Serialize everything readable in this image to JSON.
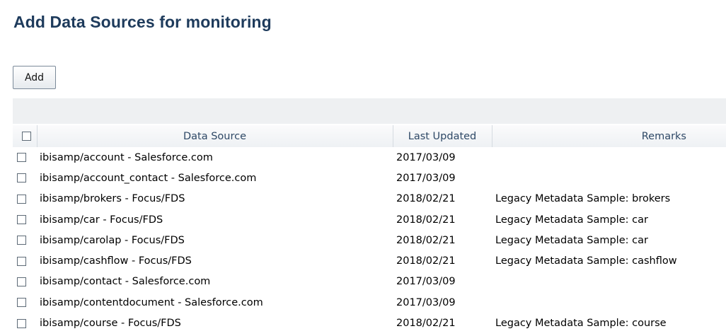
{
  "header": {
    "title": "Add Data Sources for monitoring"
  },
  "toolbar": {
    "add_label": "Add"
  },
  "table": {
    "columns": {
      "source": "Data Source",
      "updated": "Last Updated",
      "remarks": "Remarks"
    },
    "rows": [
      {
        "source": "ibisamp/account - Salesforce.com",
        "updated": "2017/03/09",
        "remarks": ""
      },
      {
        "source": "ibisamp/account_contact - Salesforce.com",
        "updated": "2017/03/09",
        "remarks": ""
      },
      {
        "source": "ibisamp/brokers - Focus/FDS",
        "updated": "2018/02/21",
        "remarks": "Legacy Metadata Sample: brokers"
      },
      {
        "source": "ibisamp/car - Focus/FDS",
        "updated": "2018/02/21",
        "remarks": "Legacy Metadata Sample: car"
      },
      {
        "source": "ibisamp/carolap - Focus/FDS",
        "updated": "2018/02/21",
        "remarks": "Legacy Metadata Sample: car"
      },
      {
        "source": "ibisamp/cashflow - Focus/FDS",
        "updated": "2018/02/21",
        "remarks": "Legacy Metadata Sample: cashflow"
      },
      {
        "source": "ibisamp/contact - Salesforce.com",
        "updated": "2017/03/09",
        "remarks": ""
      },
      {
        "source": "ibisamp/contentdocument - Salesforce.com",
        "updated": "2017/03/09",
        "remarks": ""
      },
      {
        "source": "ibisamp/course - Focus/FDS",
        "updated": "2018/02/21",
        "remarks": "Legacy Metadata Sample: course"
      }
    ]
  }
}
